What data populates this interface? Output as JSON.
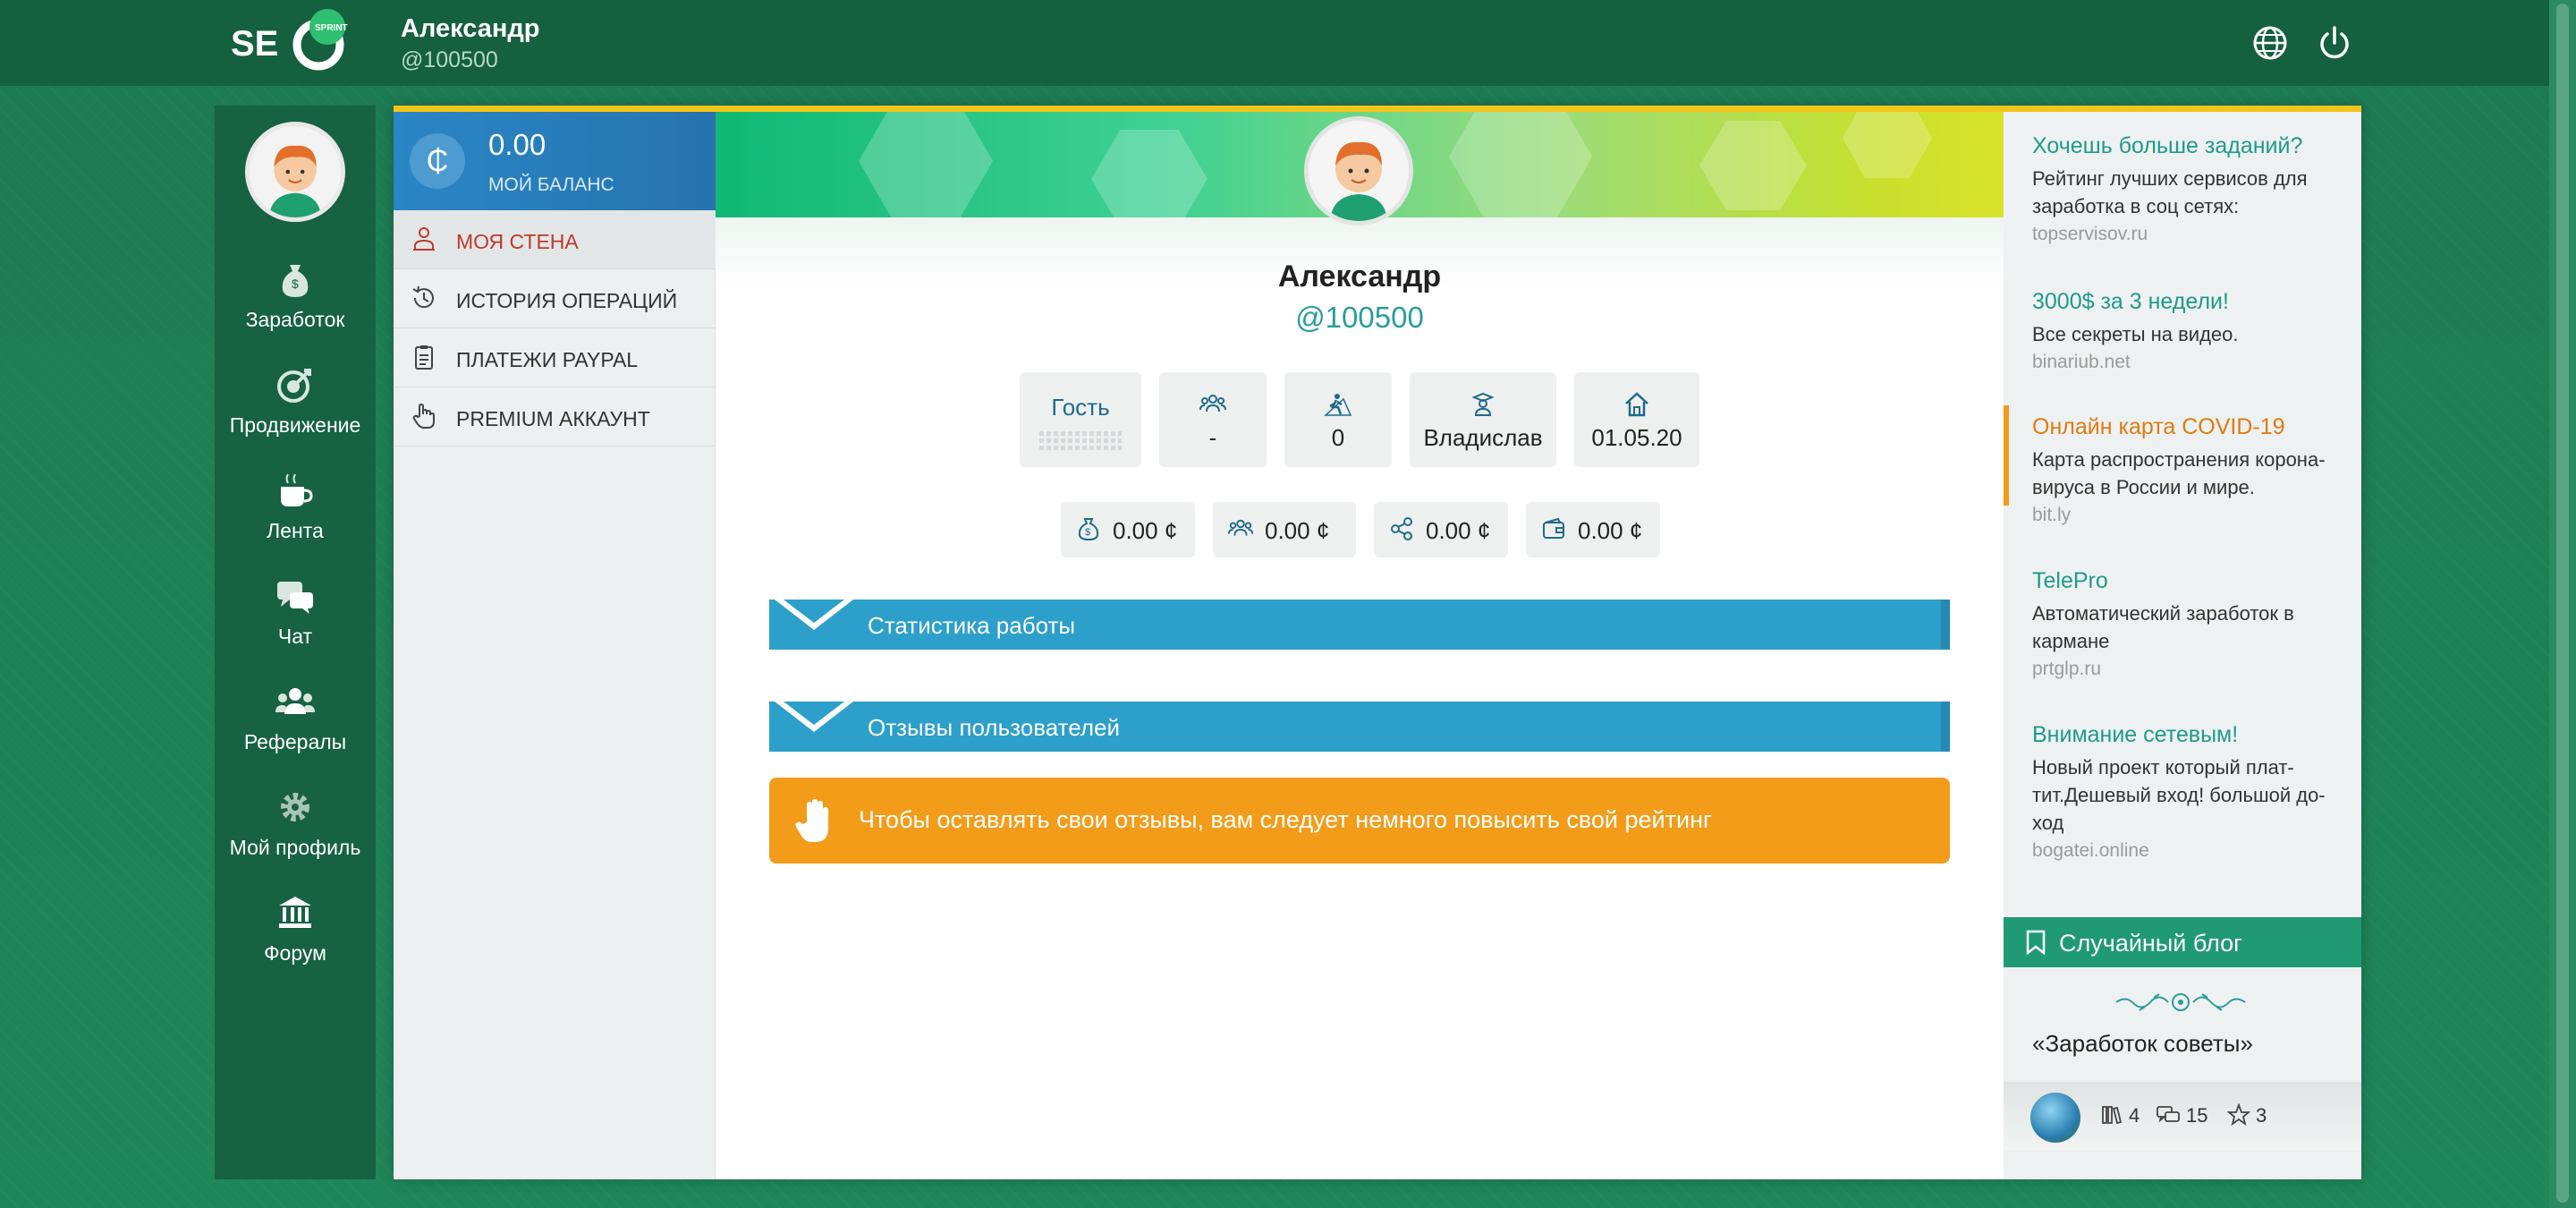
{
  "app": {
    "logo_text": "SEO SPRINT",
    "user_name": "Александр",
    "user_handle": "@100500"
  },
  "left_nav": [
    {
      "label": "Заработок",
      "icon": "money-bag-icon"
    },
    {
      "label": "Продвижение",
      "icon": "promotion-icon"
    },
    {
      "label": "Лента",
      "icon": "coffee-cup-icon"
    },
    {
      "label": "Чат",
      "icon": "chat-icon"
    },
    {
      "label": "Рефералы",
      "icon": "referrals-icon"
    },
    {
      "label": "Мой профиль",
      "icon": "gear-icon"
    },
    {
      "label": "Форум",
      "icon": "forum-building-icon"
    }
  ],
  "balance": {
    "amount": "0.00",
    "label": "МОЙ БАЛАНС",
    "currency_symbol": "₵"
  },
  "menu": [
    {
      "label": "МОЯ СТЕНА",
      "icon": "wall-icon",
      "active": true
    },
    {
      "label": "ИСТОРИЯ ОПЕРАЦИЙ",
      "icon": "history-icon",
      "active": false
    },
    {
      "label": "ПЛАТЕЖИ PAYPAL",
      "icon": "clipboard-icon",
      "active": false
    },
    {
      "label": "PREMIUM АККАУНТ",
      "icon": "hand-pointer-icon",
      "active": false
    }
  ],
  "profile": {
    "name": "Александр",
    "handle": "@100500",
    "stats": [
      {
        "value": "Гость",
        "icon": "status-icon"
      },
      {
        "value": "-",
        "icon": "group-icon"
      },
      {
        "value": "0",
        "icon": "climber-icon"
      },
      {
        "value": "Владислав",
        "icon": "referrer-icon"
      },
      {
        "value": "01.05.20",
        "icon": "home-icon"
      }
    ],
    "money": [
      {
        "value": "0.00 ¢",
        "icon": "money-bag-icon"
      },
      {
        "value": "0.00 ¢",
        "icon": "group-icon"
      },
      {
        "value": "0.00 ¢",
        "icon": "share-icon"
      },
      {
        "value": "0.00 ¢",
        "icon": "wallet-icon"
      }
    ]
  },
  "sections": {
    "work_stats": "Статистика работы",
    "reviews": "Отзывы пользователей"
  },
  "alert": {
    "text": "Чтобы оставлять свои отзывы, вам следует немного повысить свой рейтинг"
  },
  "ads": [
    {
      "title": "Хочешь больше заданий?",
      "desc": "Рейтинг лучших сервисов для заработка в соц сетях:",
      "url": "topservisov.ru",
      "highlight": false
    },
    {
      "title": "3000$ за 3 недели!",
      "desc": "Все секреты на видео.",
      "url": "binariub.net",
      "highlight": false
    },
    {
      "title": "Онлайн карта COVID-19",
      "desc": "Карта распространения корона-вируса в России и мире.",
      "url": "bit.ly",
      "highlight": true
    },
    {
      "title": "TelePro",
      "desc": "Автоматический заработок в кармане",
      "url": "prtglp.ru",
      "highlight": false
    },
    {
      "title": "Внимание сетевым!",
      "desc": "Новый проект который плат-тит.Дешевый вход! большой до-ход",
      "url": "bogatei.online",
      "highlight": false
    }
  ],
  "random_blog": {
    "header": "Случайный блог",
    "title": "«Заработок советы»",
    "books": "4",
    "comments": "15",
    "stars": "3"
  },
  "colors": {
    "page_bg": "#1f7f57",
    "topbar": "#15603f",
    "balance_blue": "#2a86c5",
    "accordion_blue": "#2c9fcb",
    "alert_orange": "#f29c1a",
    "ad_link": "#1f9a8a",
    "blog_header": "#1f9a75",
    "accent_yellow": "#f2c51a"
  }
}
